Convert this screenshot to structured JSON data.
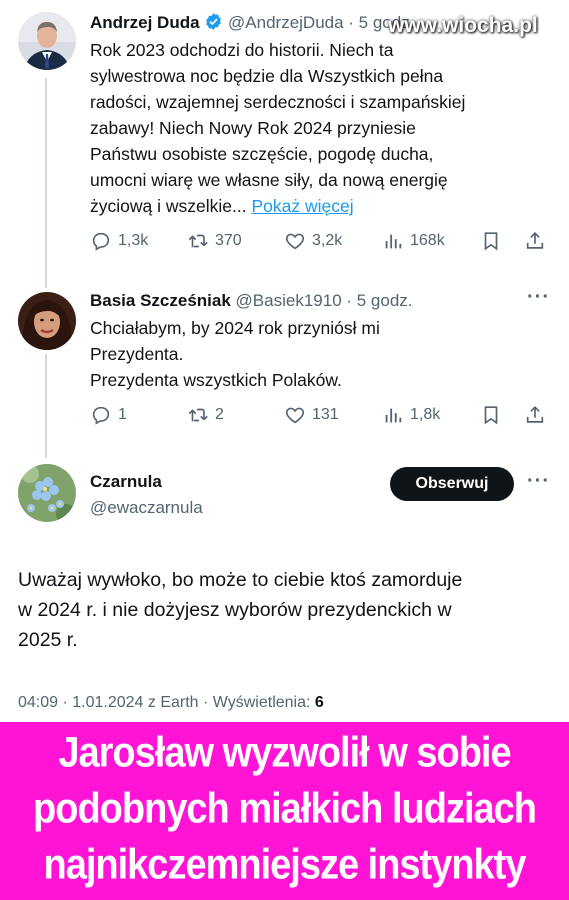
{
  "watermark": "www.wiocha.pl",
  "tweets": [
    {
      "name": "Andrzej Duda",
      "handle": "@AndrzejDuda · 5 godz.",
      "verified": true,
      "text_lines": [
        "Rok 2023 odchodzi do historii. Niech ta",
        "sylwestrowa noc będzie dla Wszystkich pełna",
        "radości, wzajemnej serdeczności i szampańskiej",
        "zabawy! Niech Nowy Rok 2024 przyniesie",
        "Państwu osobiste szczęście, pogodę ducha,",
        "umocni wiarę we własne siły, da nową energię",
        "życiową i wszelkie..."
      ],
      "show_more": "Pokaż więcej",
      "replies": "1,3k",
      "retweets": "370",
      "likes": "3,2k",
      "views": "168k"
    },
    {
      "name": "Basia Szcześniak",
      "handle": "@Basiek1910 · 5 godz.",
      "text_lines": [
        "Chciałabym, by 2024 rok przyniósł mi",
        "Prezydenta.",
        "Prezydenta wszystkich Polaków."
      ],
      "replies": "1",
      "retweets": "2",
      "likes": "131",
      "views": "1,8k"
    }
  ],
  "main_tweet": {
    "name": "Czarnula",
    "handle": "@ewaczarnula",
    "follow_label": "Obserwuj",
    "text_lines": [
      "Uważaj wywłoko, bo może to ciebie ktoś zamorduje",
      "w 2024 r. i nie dożyjesz wyborów prezydenckich w",
      "2025 r."
    ],
    "meta_prefix": "04:09 · 1.01.2024 z Earth · Wyświetlenia:",
    "meta_views": "6"
  },
  "banner": {
    "lines": [
      "Jarosław wyzwolił w sobie",
      "podobnych miałkich  ludziach",
      "najnikczemniejsze instynkty"
    ],
    "color": "#ff14d6"
  },
  "colors": {
    "text": "#0f1419",
    "muted": "#536471",
    "link": "#1d9bf0",
    "verified": "#1d9bf0"
  }
}
